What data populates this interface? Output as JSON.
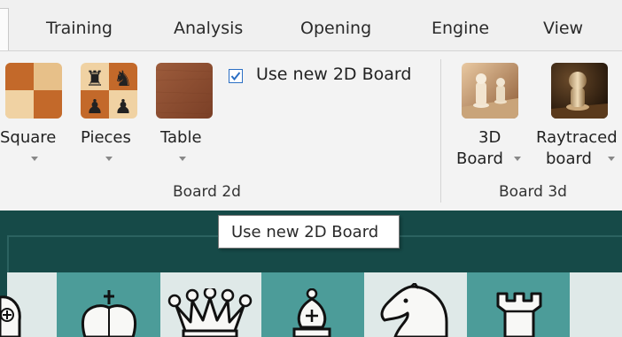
{
  "tabs": [
    "Training",
    "Analysis",
    "Opening",
    "Engine",
    "View"
  ],
  "ribbon": {
    "board2d": {
      "square": {
        "label": "Square"
      },
      "pieces": {
        "label": "Pieces"
      },
      "table": {
        "label": "Table"
      },
      "checkbox": {
        "label": "Use new 2D Board",
        "checked": true
      },
      "group_label": "Board 2d"
    },
    "board3d": {
      "board3d": {
        "label_line1": "3D",
        "label_line2": "Board"
      },
      "raytraced": {
        "label_line1": "Raytraced",
        "label_line2": "board"
      },
      "group_label": "Board 3d"
    }
  },
  "tooltip": {
    "text": "Use new 2D Board"
  },
  "colors": {
    "accent": "#2b6fc4",
    "board_frame": "#164a48",
    "light_square": "#dfe9e8",
    "dark_square": "#4c9c99"
  },
  "board": {
    "visible_pieces": [
      "king",
      "king",
      "queen",
      "bishop",
      "knight",
      "rook"
    ]
  }
}
